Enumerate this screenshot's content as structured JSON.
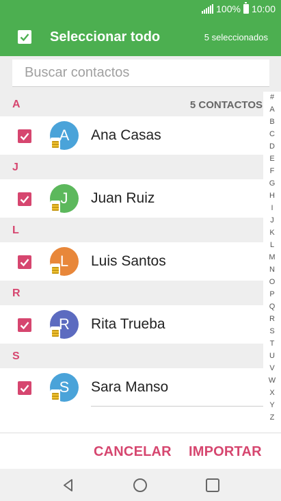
{
  "status_bar": {
    "battery": "100%",
    "time": "10:00"
  },
  "header": {
    "title": "Seleccionar todo",
    "selected_count": "5 seleccionados",
    "select_all_checked": true
  },
  "search": {
    "placeholder": "Buscar contactos",
    "value": ""
  },
  "list": {
    "total_label": "5 CONTACTOS",
    "sections": [
      {
        "letter": "A",
        "contact": {
          "name": "Ana Casas",
          "initial": "A",
          "avatar_color": "#4aa3d9",
          "checked": true
        }
      },
      {
        "letter": "J",
        "contact": {
          "name": "Juan Ruiz",
          "initial": "J",
          "avatar_color": "#5cb85c",
          "checked": true
        }
      },
      {
        "letter": "L",
        "contact": {
          "name": "Luis Santos",
          "initial": "L",
          "avatar_color": "#e8873a",
          "checked": true
        }
      },
      {
        "letter": "R",
        "contact": {
          "name": "Rita Trueba",
          "initial": "R",
          "avatar_color": "#5c6bc0",
          "checked": true
        }
      },
      {
        "letter": "S",
        "contact": {
          "name": "Sara Manso",
          "initial": "S",
          "avatar_color": "#4aa3d9",
          "checked": true
        }
      }
    ]
  },
  "alpha_index": [
    "#",
    "A",
    "B",
    "C",
    "D",
    "E",
    "F",
    "G",
    "H",
    "I",
    "J",
    "K",
    "L",
    "M",
    "N",
    "O",
    "P",
    "Q",
    "R",
    "S",
    "T",
    "U",
    "V",
    "W",
    "X",
    "Y",
    "Z"
  ],
  "footer": {
    "cancel_label": "CANCELAR",
    "import_label": "IMPORTAR"
  },
  "colors": {
    "primary_green": "#4caf50",
    "accent_pink": "#d6466f"
  },
  "nav_icons": [
    "back-icon",
    "home-icon",
    "recents-icon"
  ]
}
